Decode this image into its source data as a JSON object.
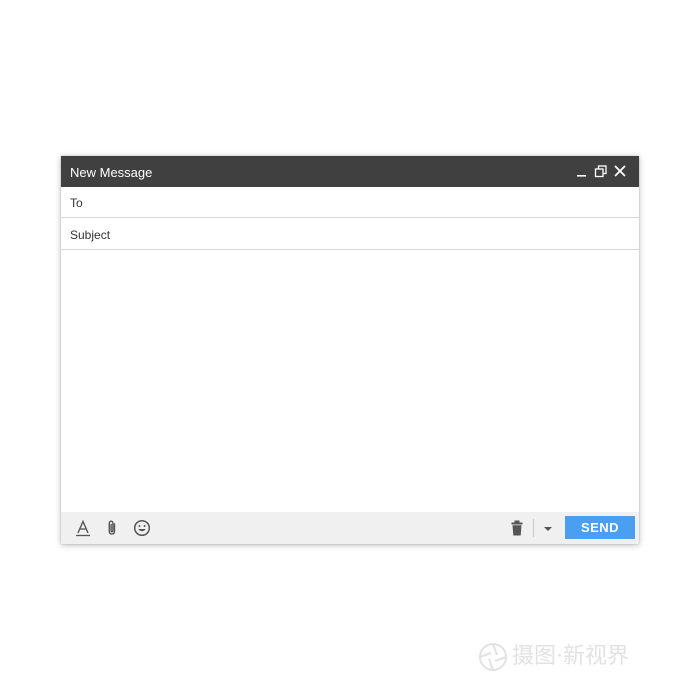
{
  "window": {
    "title": "New Message",
    "controls": [
      "minimize-icon",
      "restore-icon",
      "close-icon"
    ],
    "titlebar_color": "#404040"
  },
  "fields": {
    "to": {
      "label": "To",
      "value": ""
    },
    "subject": {
      "label": "Subject",
      "value": ""
    }
  },
  "body": {
    "value": ""
  },
  "toolbar": {
    "left_tools": [
      "text-format-icon",
      "attachment-icon",
      "emoji-icon"
    ],
    "right_tools": [
      "trash-icon",
      "caret-down-icon"
    ],
    "send_label": "SEND",
    "send_color": "#4a9ff0",
    "background_color": "#f0f0f0"
  },
  "watermark": {
    "text": "摄图·新视界"
  }
}
